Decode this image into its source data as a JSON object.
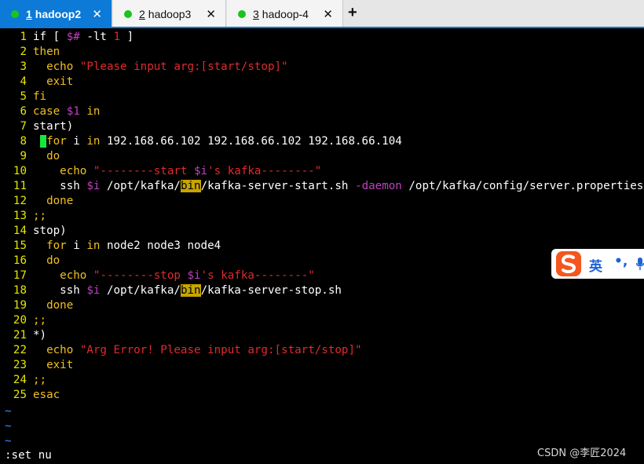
{
  "tabs": [
    {
      "num": "1",
      "label": "hadoop2",
      "close": "✕"
    },
    {
      "num": "2",
      "label": "hadoop3",
      "close": "✕"
    },
    {
      "num": "3",
      "label": "hadoop-4",
      "close": "✕"
    }
  ],
  "add_tab": "+",
  "lines": [
    {
      "n": "1",
      "seg": [
        [
          "w",
          "if [ "
        ],
        [
          "v",
          "$#"
        ],
        [
          "w",
          " -lt "
        ],
        [
          "s",
          "1"
        ],
        [
          "w",
          " ]"
        ]
      ]
    },
    {
      "n": "2",
      "seg": [
        [
          "k",
          "then"
        ]
      ]
    },
    {
      "n": "3",
      "seg": [
        [
          "w",
          "  "
        ],
        [
          "k",
          "echo"
        ],
        [
          "w",
          " "
        ],
        [
          "s",
          "\"Please input arg:[start/stop]\""
        ]
      ]
    },
    {
      "n": "4",
      "seg": [
        [
          "w",
          "  "
        ],
        [
          "k",
          "exit"
        ]
      ]
    },
    {
      "n": "5",
      "seg": [
        [
          "k",
          "fi"
        ]
      ]
    },
    {
      "n": "6",
      "seg": [
        [
          "k",
          "case"
        ],
        [
          "w",
          " "
        ],
        [
          "v",
          "$1"
        ],
        [
          "w",
          " "
        ],
        [
          "k",
          "in"
        ]
      ]
    },
    {
      "n": "7",
      "seg": [
        [
          "w",
          "start)"
        ]
      ]
    },
    {
      "n": "8",
      "seg": [
        [
          "w",
          " "
        ],
        [
          "cur",
          " "
        ],
        [
          "k",
          "for"
        ],
        [
          "w",
          " i "
        ],
        [
          "k",
          "in"
        ],
        [
          "w",
          " 192.168.66.102 192.168.66.102 192.168.66.104"
        ]
      ]
    },
    {
      "n": "9",
      "seg": [
        [
          "w",
          "  "
        ],
        [
          "k",
          "do"
        ]
      ]
    },
    {
      "n": "10",
      "seg": [
        [
          "w",
          "    "
        ],
        [
          "k",
          "echo"
        ],
        [
          "w",
          " "
        ],
        [
          "s",
          "\"--------start "
        ],
        [
          "v",
          "$i"
        ],
        [
          "s",
          "'s kafka--------\""
        ]
      ]
    },
    {
      "n": "11",
      "seg": [
        [
          "w",
          "    ssh "
        ],
        [
          "v",
          "$i"
        ],
        [
          "w",
          " /opt/kafka/"
        ],
        [
          "hl",
          "bin"
        ],
        [
          "w",
          "/kafka-server-start.sh "
        ],
        [
          "v",
          "-daemon"
        ],
        [
          "w",
          " /opt/kafka/config/server.properties"
        ]
      ]
    },
    {
      "n": "12",
      "seg": [
        [
          "w",
          "  "
        ],
        [
          "k",
          "done"
        ]
      ]
    },
    {
      "n": "13",
      "seg": [
        [
          "k",
          ";;"
        ]
      ]
    },
    {
      "n": "14",
      "seg": [
        [
          "w",
          "stop)"
        ]
      ]
    },
    {
      "n": "15",
      "seg": [
        [
          "w",
          "  "
        ],
        [
          "k",
          "for"
        ],
        [
          "w",
          " i "
        ],
        [
          "k",
          "in"
        ],
        [
          "w",
          " node2 node3 node4"
        ]
      ]
    },
    {
      "n": "16",
      "seg": [
        [
          "w",
          "  "
        ],
        [
          "k",
          "do"
        ]
      ]
    },
    {
      "n": "17",
      "seg": [
        [
          "w",
          "    "
        ],
        [
          "k",
          "echo"
        ],
        [
          "w",
          " "
        ],
        [
          "s",
          "\"--------stop "
        ],
        [
          "v",
          "$i"
        ],
        [
          "s",
          "'s kafka--------\""
        ]
      ]
    },
    {
      "n": "18",
      "seg": [
        [
          "w",
          "    ssh "
        ],
        [
          "v",
          "$i"
        ],
        [
          "w",
          " /opt/kafka/"
        ],
        [
          "hl",
          "bin"
        ],
        [
          "w",
          "/kafka-server-stop.sh"
        ]
      ]
    },
    {
      "n": "19",
      "seg": [
        [
          "w",
          "  "
        ],
        [
          "k",
          "done"
        ]
      ]
    },
    {
      "n": "20",
      "seg": [
        [
          "k",
          ";;"
        ]
      ]
    },
    {
      "n": "21",
      "seg": [
        [
          "w",
          "*)"
        ]
      ]
    },
    {
      "n": "22",
      "seg": [
        [
          "w",
          "  "
        ],
        [
          "k",
          "echo"
        ],
        [
          "w",
          " "
        ],
        [
          "s",
          "\"Arg Error! Please input arg:[start/stop]\""
        ]
      ]
    },
    {
      "n": "23",
      "seg": [
        [
          "w",
          "  "
        ],
        [
          "k",
          "exit"
        ]
      ]
    },
    {
      "n": "24",
      "seg": [
        [
          "k",
          ";;"
        ]
      ]
    },
    {
      "n": "25",
      "seg": [
        [
          "k",
          "esac"
        ]
      ]
    }
  ],
  "tildes": [
    "~",
    "~",
    "~"
  ],
  "command": ":set nu",
  "ime": {
    "lang": "英",
    "punct": "•,"
  },
  "watermark": "CSDN @李匠2024",
  "colors": {
    "tab_active": "#0c7ad6",
    "status_dot": "#19c41e",
    "line_number": "#e6e600",
    "keyword": "#f0c020",
    "string": "#e02a2a",
    "variable": "#c040c0",
    "search_highlight": "#c7a500",
    "cursor": "#18e83c",
    "tilde": "#3b8cff"
  }
}
